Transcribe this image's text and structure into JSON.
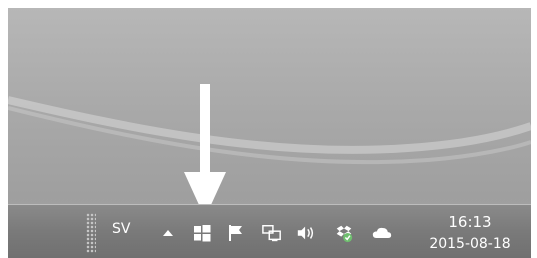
{
  "taskbar": {
    "language": "SV",
    "clock": {
      "time": "16:13",
      "date": "2015-08-18"
    },
    "tray_icons": [
      "show-hidden-icons-chevron",
      "windows-logo-icon",
      "action-center-flag-icon",
      "network-icon",
      "volume-icon",
      "dropbox-synced-icon",
      "onedrive-cloud-icon"
    ]
  },
  "annotation": {
    "arrow_color": "#ffffff",
    "points_to": "windows-logo-icon"
  }
}
